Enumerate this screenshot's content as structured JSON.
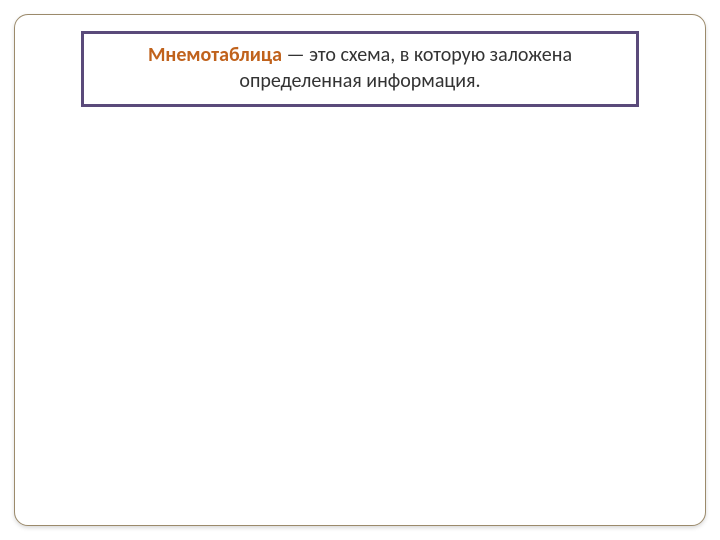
{
  "definition": {
    "term": "Мнемотаблица",
    "rest": " — это схема, в которую заложена определенная информация."
  },
  "colors": {
    "frame_border": "#9b8a6b",
    "box_border": "#5a4a7a",
    "term_color": "#c0621c"
  }
}
